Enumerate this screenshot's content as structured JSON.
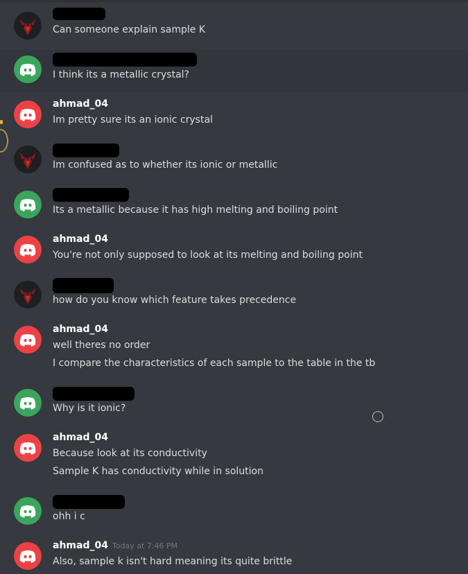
{
  "messages": [
    {
      "author": "",
      "avatar": "dark-emblem",
      "lines": [
        "Can someone explain sample K"
      ]
    },
    {
      "author": "",
      "avatar": "discord-green",
      "lines": [
        "I think its a metallic crystal?"
      ]
    },
    {
      "author": "ahmad_04",
      "avatar": "discord-red",
      "lines": [
        "Im pretty sure its an ionic crystal"
      ]
    },
    {
      "author": "",
      "avatar": "dark-emblem",
      "lines": [
        "Im confused as to whether its ionic or metallic"
      ]
    },
    {
      "author": "",
      "avatar": "discord-green",
      "lines": [
        "Its a metallic because it has high melting and boiling point"
      ]
    },
    {
      "author": "ahmad_04",
      "avatar": "discord-red",
      "lines": [
        "You're not only supposed to look at its melting and boiling point"
      ]
    },
    {
      "author": "",
      "avatar": "dark-emblem",
      "lines": [
        "how do you know which feature takes precedence"
      ]
    },
    {
      "author": "ahmad_04",
      "avatar": "discord-red",
      "lines": [
        "well theres no order",
        "I compare the characteristics of each sample to the table in the tb"
      ]
    },
    {
      "author": "",
      "avatar": "discord-green",
      "lines": [
        "Why is it ionic?"
      ]
    },
    {
      "author": "ahmad_04",
      "avatar": "discord-red",
      "lines": [
        "Because look at its conductivity",
        "Sample K has conductivity while in solution"
      ]
    },
    {
      "author": "",
      "avatar": "discord-green",
      "lines": [
        "ohh i c"
      ]
    },
    {
      "author": "ahmad_04",
      "avatar": "discord-red",
      "timestamp": "Today at 7:46 PM",
      "lines": [
        "Also, sample k isn't hard meaning its quite brittle"
      ]
    }
  ],
  "colors": {
    "background": "#36393f",
    "green_avatar": "#3ba55d",
    "red_avatar": "#ed4245",
    "username": "#ffffff",
    "message_text": "#dcddde",
    "timestamp": "#72767d"
  }
}
